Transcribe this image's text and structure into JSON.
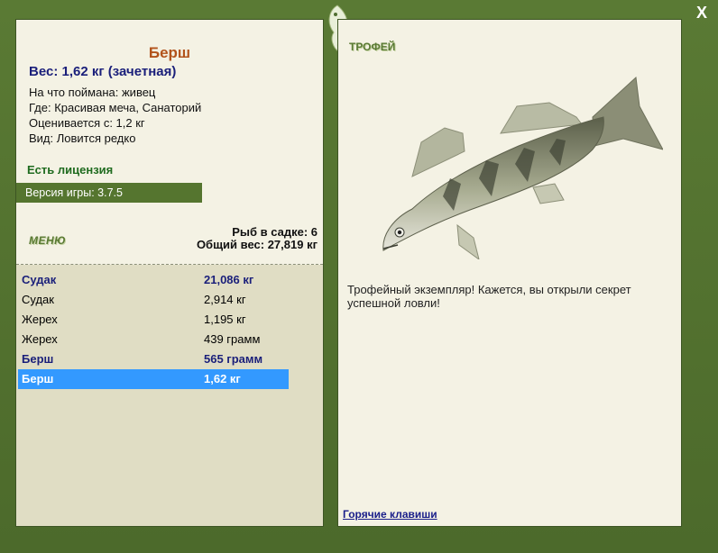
{
  "header": {
    "close_label": "X"
  },
  "fish_card": {
    "name": "Берш",
    "weight": "Вес: 1,62 кг (зачетная)",
    "caught_on": "На что поймана: живец",
    "location": "Где: Красивая меча, Санаторий",
    "valued_from": "Оценивается с: 1,2 кг",
    "species_note": "Вид: Ловится редко"
  },
  "license": "Есть лицензия",
  "version": "Версия игры: 3.7.5",
  "menu_label": "МЕНЮ",
  "cage": {
    "count": "Рыб в садке: 6",
    "total": "Общий вес: 27,819 кг"
  },
  "catch_list": [
    {
      "name": "Судак",
      "weight": "21,086 кг"
    },
    {
      "name": "Судак",
      "weight": "2,914 кг"
    },
    {
      "name": "Жерех",
      "weight": "1,195 кг"
    },
    {
      "name": "Жерех",
      "weight": "439 грамм"
    },
    {
      "name": "Берш",
      "weight": "565 грамм"
    },
    {
      "name": "Берш",
      "weight": "1,62 кг"
    }
  ],
  "trophy": {
    "label": "ТРОФЕЙ",
    "description": "Трофейный экземпляр! Кажется, вы открыли секрет успешной ловли!"
  },
  "hotkeys_link": "Горячие клавиши",
  "colors": {
    "frame": "#55752f",
    "panel": "#f4f2e4",
    "selected": "#3399ff",
    "title": "#b2531b",
    "accent": "#1a1f7a"
  }
}
